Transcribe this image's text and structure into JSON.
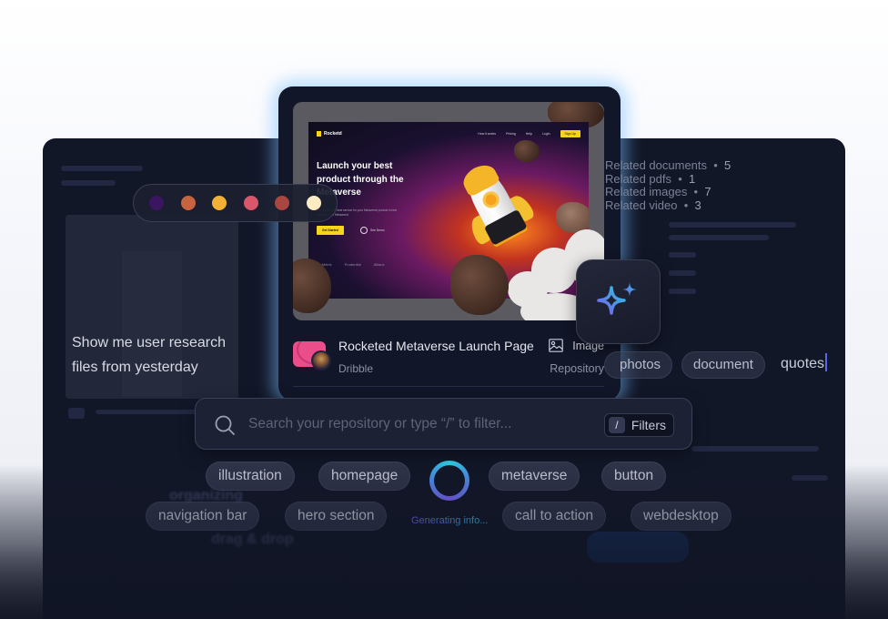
{
  "tablet_preview": {
    "site": {
      "brand": "Rocketd",
      "nav_links": [
        "How it works",
        "Pricing",
        "Help",
        "Login"
      ],
      "signup_label": "Sign Up",
      "headline": "Launch your best product through the Metaverse",
      "subtext": "We provide the best service for your Metaverse product in real world and the Metaworld",
      "cta_primary": "Get Started",
      "cta_secondary": "See Demo",
      "partners": [
        "BioMetrix",
        "Prudential",
        "Allianz"
      ]
    },
    "item": {
      "title": "Rocketed Metaverse Launch Page",
      "source": "Dribble",
      "type_label": "Image",
      "location": "Repository",
      "type_icon": "image-icon",
      "source_icon": "dribbble-icon"
    }
  },
  "palette": {
    "colors": [
      "#3a1560",
      "#c7643f",
      "#f2b134",
      "#d9576a",
      "#a8463f",
      "#fdebc4"
    ]
  },
  "chat": {
    "query_line1": "Show me user research",
    "query_line2": "files from yesterday"
  },
  "related": [
    {
      "label": "Related documents",
      "count": "5"
    },
    {
      "label": "Related pdfs",
      "count": "1"
    },
    {
      "label": "Related images",
      "count": "7"
    },
    {
      "label": "Related video",
      "count": "3"
    }
  ],
  "ai_button": {
    "icon": "sparkles-icon"
  },
  "filter_tags": {
    "chips": [
      "photos",
      "document"
    ],
    "typed_text": "quotes"
  },
  "search": {
    "placeholder": "Search your repository or type “/” to filter...",
    "value": "",
    "filters_key": "/",
    "filters_label": "Filters"
  },
  "suggestions": {
    "row1": [
      "illustration",
      "homepage",
      "metaverse",
      "button"
    ],
    "row2": [
      "navigation bar",
      "hero section",
      "call to action",
      "webdesktop"
    ],
    "status": "Generating info..."
  },
  "background_hints": {
    "drag_text": "drag & drop",
    "org_text": "organizing"
  }
}
